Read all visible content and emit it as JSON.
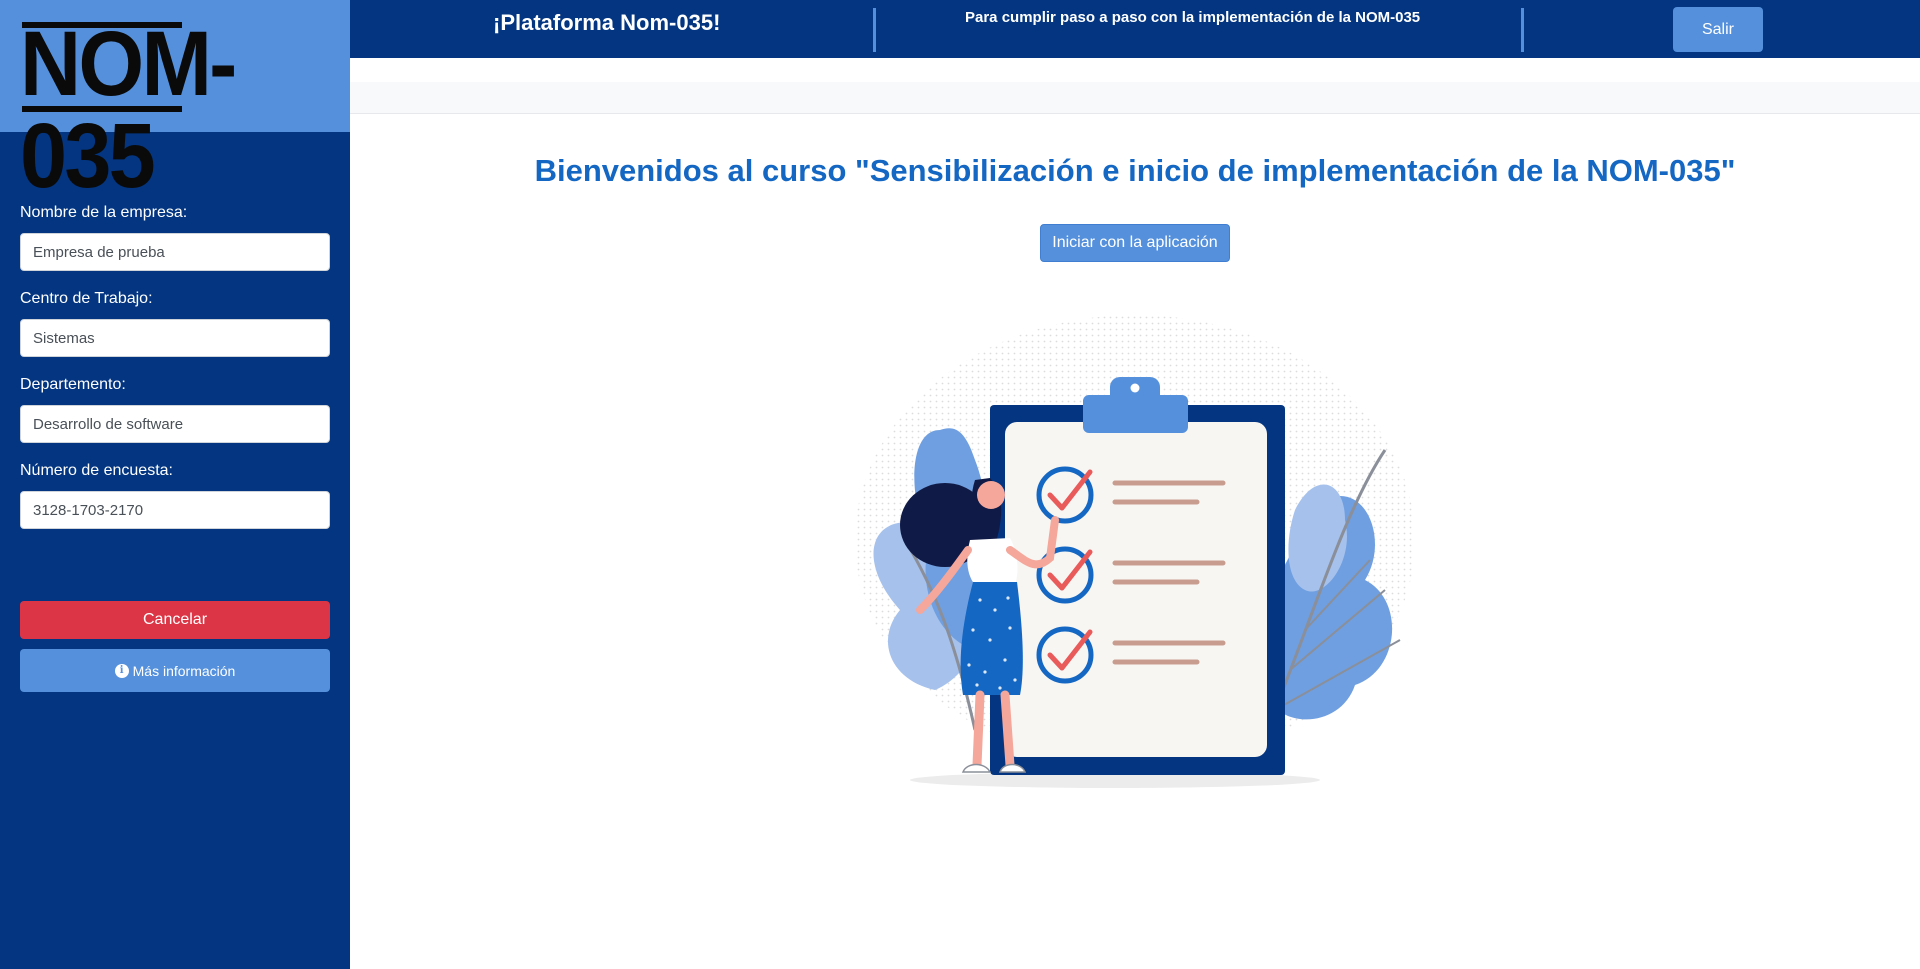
{
  "sidebar": {
    "logo_text": "NOM-035",
    "fields": [
      {
        "label": "Nombre de la empresa:",
        "value": "Empresa de prueba"
      },
      {
        "label": "Centro de Trabajo:",
        "value": "Sistemas"
      },
      {
        "label": "Departemento:",
        "value": "Desarrollo de software"
      },
      {
        "label": "Número de encuesta:",
        "value": "3128-1703-2170"
      }
    ],
    "cancel_label": "Cancelar",
    "info_label": "Más información",
    "info_icon": "info-circle-icon"
  },
  "header": {
    "title": "¡Plataforma Nom-035!",
    "subtitle": "Para cumplir paso a paso con la implementación de la NOM-035",
    "exit_label": "Salir"
  },
  "main": {
    "welcome": "Bienvenidos al curso \"Sensibilización e inicio de implementación de la NOM-035\"",
    "start_label": "Iniciar con la aplicación"
  },
  "colors": {
    "navy": "#033580",
    "accent_blue": "#5490dc",
    "danger": "#dc3545",
    "title_blue": "#1467c2"
  }
}
